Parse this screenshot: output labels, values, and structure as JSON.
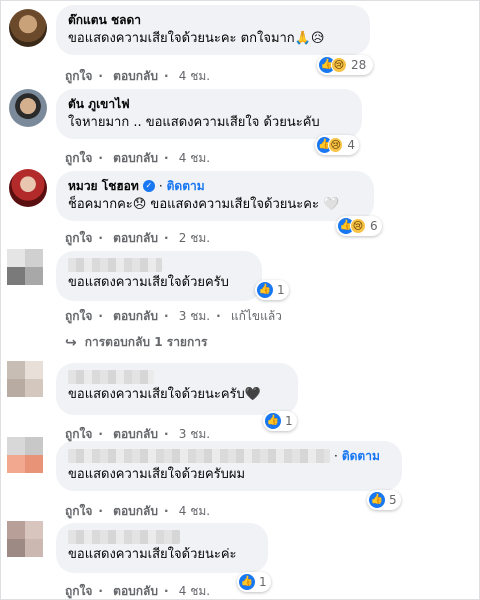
{
  "comments": [
    {
      "name": "ต๊กแตน ชลดา",
      "text": "ขอแสดงความเสียใจด้วยนะคะ ตกใจมาก🙏😥",
      "like": "ถูกใจ",
      "reply": "ตอบกลับ",
      "time": "4 ชม.",
      "reactions": {
        "count": "28",
        "icons": [
          "like-icon",
          "sad-icon"
        ]
      }
    },
    {
      "name": "ตัน ภูเขาไฟ",
      "text": "ใจหายมาก .. ขอแสดงความเสียใจ ด้วยนะคับ",
      "like": "ถูกใจ",
      "reply": "ตอบกลับ",
      "time": "4 ชม.",
      "reactions": {
        "count": "4",
        "icons": [
          "like-icon",
          "sad-icon"
        ]
      }
    },
    {
      "name": "หมวย โชฮอท",
      "follow": "ติดตาม",
      "text": "ช็อคมากคะ😞 ขอแสดงความเสียใจด้วยนะคะ 🤍",
      "like": "ถูกใจ",
      "reply": "ตอบกลับ",
      "time": "2 ชม.",
      "reactions": {
        "count": "6",
        "icons": [
          "like-icon",
          "sad-icon"
        ]
      }
    },
    {
      "text": "ขอแสดงความเสียใจด้วยครับ",
      "like": "ถูกใจ",
      "reply": "ตอบกลับ",
      "time": "3 ชม.",
      "edited": "แก้ไขแล้ว",
      "reactions": {
        "count": "1",
        "icons": [
          "like-icon"
        ]
      },
      "replies": "การตอบกลับ 1 รายการ"
    },
    {
      "text": "ขอแสดงความเสียใจด้วยนะครับ🖤",
      "like": "ถูกใจ",
      "reply": "ตอบกลับ",
      "time": "3 ชม.",
      "reactions": {
        "count": "1",
        "icons": [
          "like-icon"
        ]
      }
    },
    {
      "follow": "ติดตาม",
      "text": "ขอแสดงความเสียใจด้วยครับผม",
      "like": "ถูกใจ",
      "reply": "ตอบกลับ",
      "time": "4 ชม.",
      "reactions": {
        "count": "5",
        "icons": [
          "like-icon"
        ]
      }
    },
    {
      "text": "ขอแสดงความเสียใจด้วยนะค่ะ",
      "like": "ถูกใจ",
      "reply": "ตอบกลับ",
      "time": "4 ชม.",
      "reactions": {
        "count": "1",
        "icons": [
          "like-icon"
        ]
      }
    }
  ],
  "dot": "·",
  "colors": {
    "link": "#1877f2",
    "bubble": "#f0f2f5",
    "meta": "#65676b"
  }
}
